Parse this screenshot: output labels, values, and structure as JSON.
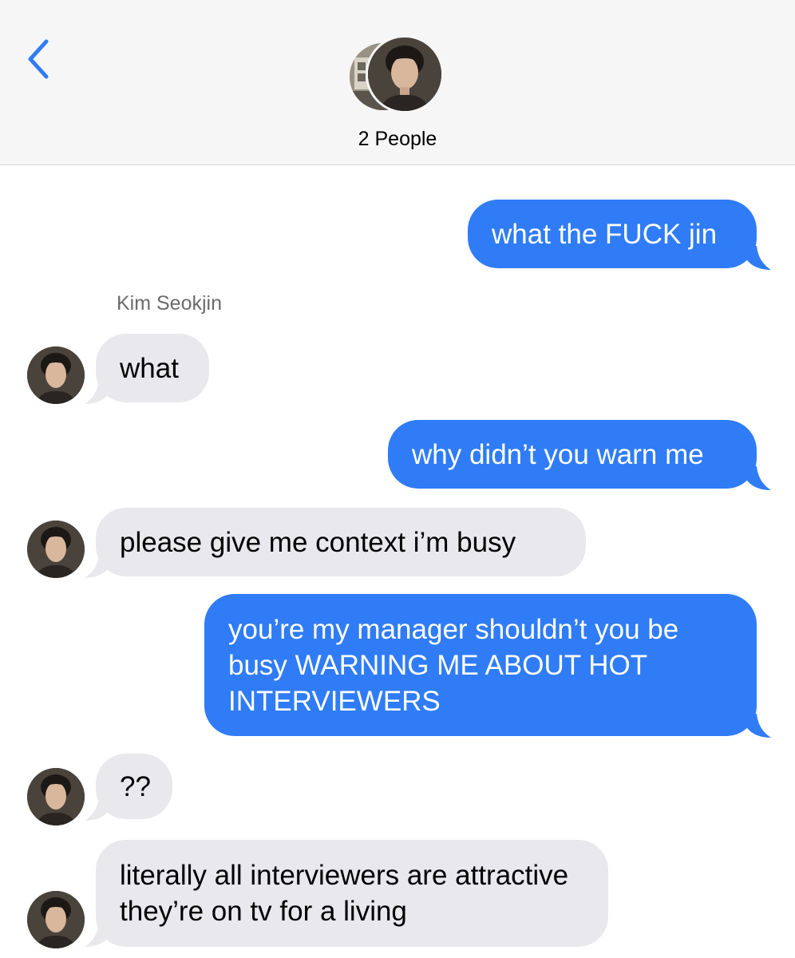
{
  "header": {
    "back_icon": "chevron-left-icon",
    "title": "2 People",
    "accent": "#2f7cf6"
  },
  "conversation": {
    "sender_name": "Kim Seokjin",
    "messages": [
      {
        "direction": "outgoing",
        "text": "what the FUCK jin"
      },
      {
        "direction": "incoming",
        "text": "what"
      },
      {
        "direction": "outgoing",
        "text": "why didn’t you warn me"
      },
      {
        "direction": "incoming",
        "text": "please give me context i’m busy"
      },
      {
        "direction": "outgoing",
        "text": "you’re my manager shouldn’t you be busy WARNING ME ABOUT HOT INTERVIEWERS"
      },
      {
        "direction": "incoming",
        "text": "??"
      },
      {
        "direction": "incoming",
        "text": "literally all interviewers are attractive they’re on tv for a living"
      }
    ]
  },
  "colors": {
    "outgoing_bubble": "#2f7cf6",
    "incoming_bubble": "#e8e8ed",
    "header_bg": "#f6f6f6"
  }
}
